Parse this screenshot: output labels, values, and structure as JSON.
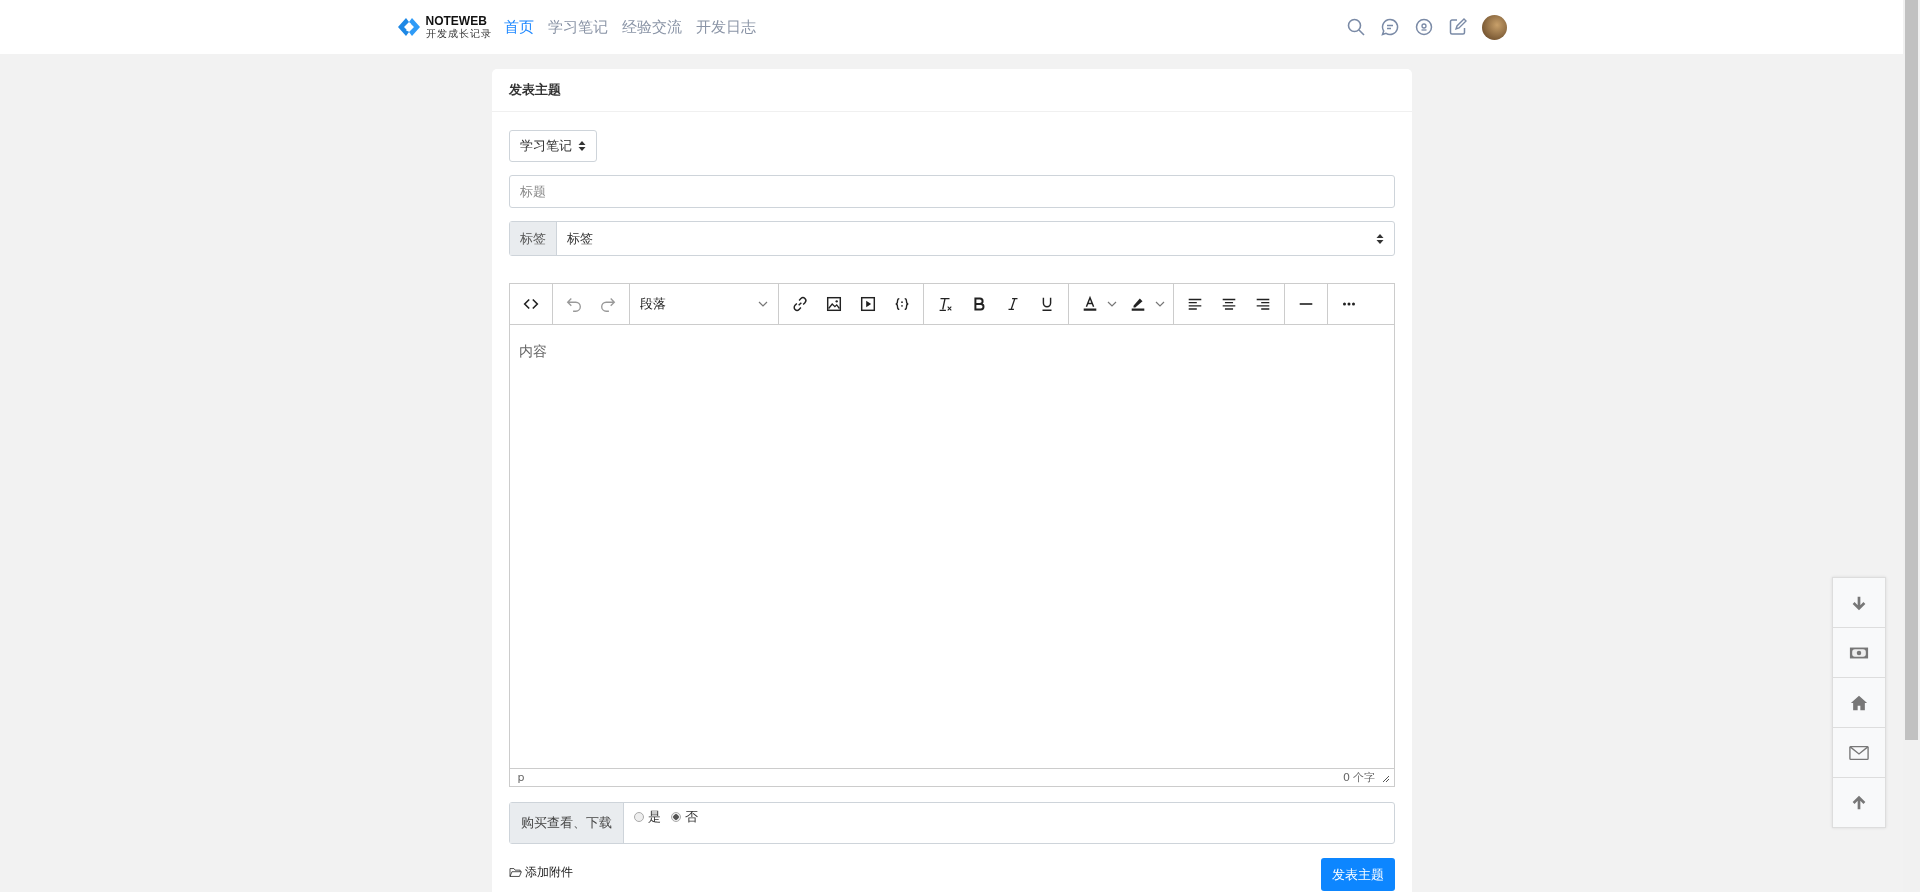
{
  "header": {
    "logo": {
      "name": "NOTEWEB",
      "tagline": "开发成长记录"
    },
    "nav": [
      {
        "label": "首页",
        "selected": true
      },
      {
        "label": "学习笔记",
        "selected": false
      },
      {
        "label": "经验交流",
        "selected": false
      },
      {
        "label": "开发日志",
        "selected": false
      }
    ]
  },
  "card": {
    "title": "发表主题",
    "category": {
      "value": "学习笔记"
    },
    "title_field": {
      "placeholder": "标题"
    },
    "tags": {
      "addon": "标签",
      "value": "标签"
    },
    "editor": {
      "toolbar": {
        "undo": {
          "disabled": true
        },
        "redo": {
          "disabled": true
        },
        "block_format": "段落"
      },
      "placeholder": "内容",
      "status_path": "p",
      "word_count": "0 个字"
    },
    "purchase": {
      "label": "购买查看、下载",
      "options": [
        {
          "label": "是",
          "selected": false
        },
        {
          "label": "否",
          "selected": true
        }
      ]
    },
    "attachment": "添加附件",
    "submit": "发表主题"
  }
}
